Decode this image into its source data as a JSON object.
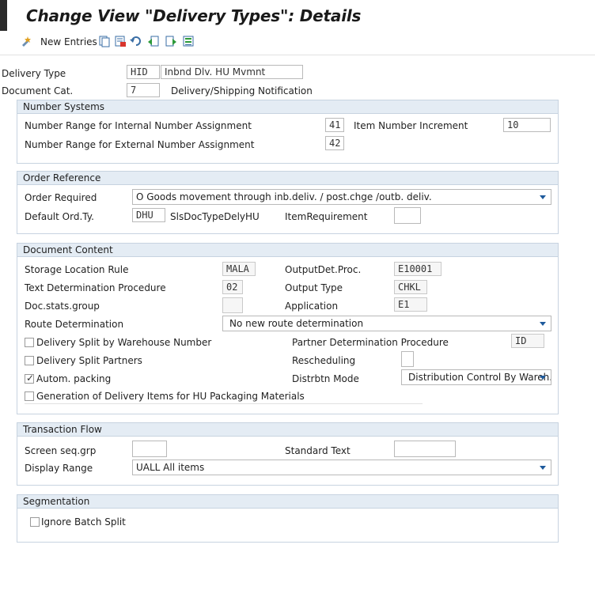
{
  "page": {
    "title": "Change View \"Delivery Types\": Details"
  },
  "toolbar": {
    "new_entries_label": "New Entries",
    "icons": [
      "new-entries-icon",
      "copy-icon",
      "delete-icon",
      "undo-icon",
      "previous-entry-icon",
      "next-entry-icon",
      "select-all-icon"
    ]
  },
  "header": {
    "delivery_type_label": "Delivery Type",
    "delivery_type_value": "HID",
    "delivery_type_desc": "Inbnd Dlv. HU Mvmnt",
    "doc_cat_label": "Document Cat.",
    "doc_cat_value": "7",
    "doc_cat_desc": "Delivery/Shipping Notification"
  },
  "number_systems": {
    "title": "Number Systems",
    "internal_label": "Number Range for Internal Number Assignment",
    "internal_value": "41",
    "item_incr_label": "Item Number Increment",
    "item_incr_value": "10",
    "external_label": "Number Range for External Number Assignment",
    "external_value": "42"
  },
  "order_reference": {
    "title": "Order Reference",
    "order_required_label": "Order Required",
    "order_required_value": "O Goods movement through inb.deliv. / post.chge /outb. deliv.",
    "default_ord_label": "Default Ord.Ty.",
    "default_ord_value": "DHU",
    "default_ord_desc": "SlsDocTypeDelyHU",
    "item_req_label": "ItemRequirement",
    "item_req_value": ""
  },
  "document_content": {
    "title": "Document Content",
    "storage_loc_label": "Storage Location Rule",
    "storage_loc_value": "MALA",
    "output_det_label": "OutputDet.Proc.",
    "output_det_value": "E10001",
    "text_det_label": "Text Determination Procedure",
    "text_det_value": "02",
    "output_type_label": "Output Type",
    "output_type_value": "CHKL",
    "doc_stats_label": "Doc.stats.group",
    "doc_stats_value": "",
    "application_label": "Application",
    "application_value": "E1",
    "route_det_label": "Route Determination",
    "route_det_value": "No new route determination",
    "split_wh_label": "Delivery Split by Warehouse Number",
    "split_wh_checked": false,
    "partner_det_label": "Partner Determination Procedure",
    "partner_det_value": "ID",
    "split_partners_label": "Delivery Split Partners",
    "split_partners_checked": false,
    "rescheduling_label": "Rescheduling",
    "rescheduling_value": "",
    "autom_packing_label": "Autom. packing",
    "autom_packing_checked": true,
    "distrbtn_label": "Distrbtn Mode",
    "distrbtn_value": "Distribution Control By Wareh...",
    "gen_items_label": "Generation of Delivery Items for HU Packaging Materials",
    "gen_items_checked": false
  },
  "transaction_flow": {
    "title": "Transaction Flow",
    "screen_seq_label": "Screen seq.grp",
    "screen_seq_value": "",
    "std_text_label": "Standard Text",
    "std_text_value": "",
    "display_range_label": "Display Range",
    "display_range_value": "UALL All items"
  },
  "segmentation": {
    "title": "Segmentation",
    "ignore_batch_label": "Ignore Batch Split",
    "ignore_batch_checked": false
  },
  "colors": {
    "group_header_bg": "#e4ecf4",
    "group_border": "#c7d3e0",
    "dropdown_arrow": "#1e5a9c"
  }
}
